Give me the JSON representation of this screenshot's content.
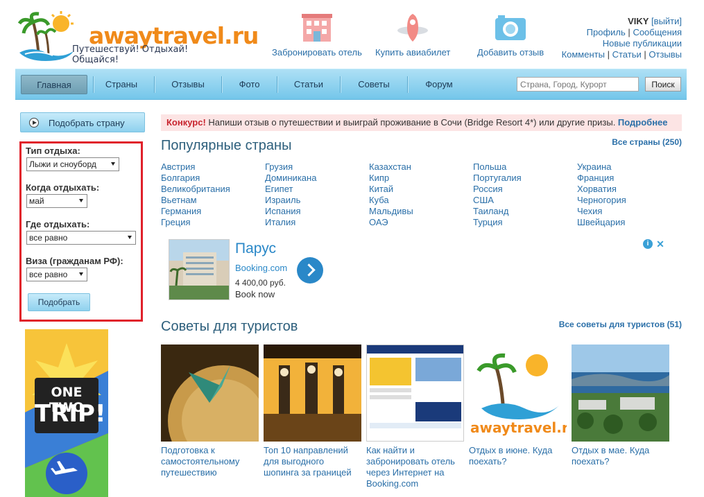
{
  "header": {
    "logo_text": "awaytravel.ru",
    "slogan": "Путешествуй! Отдыхай! Общайся!",
    "links": [
      {
        "label": "Забронировать отель",
        "icon": "hotel-icon"
      },
      {
        "label": "Купить авиабилет",
        "icon": "airplane-icon"
      },
      {
        "label": "Добавить отзыв",
        "icon": "camera-icon"
      }
    ],
    "user": {
      "name": "VIKY",
      "logout": "[выйти]",
      "profile": "Профиль",
      "messages": "Сообщения",
      "new_publications": "Новые публикации",
      "comments": "Комменты",
      "articles": "Статьи",
      "reviews": "Отзывы",
      "separator": "|"
    }
  },
  "nav": {
    "items": [
      "Главная",
      "Страны",
      "Отзывы",
      "Фото",
      "Статьи",
      "Советы",
      "Форум"
    ],
    "active": "Главная",
    "search_placeholder": "Страна, Город, Курорт",
    "search_button": "Поиск"
  },
  "sidebar": {
    "pick_country": "Подобрать страну",
    "filter": {
      "type_label": "Тип отдыха:",
      "type_value": "Лыжи и сноуборд",
      "when_label": "Когда отдыхать:",
      "when_value": "май",
      "where_label": "Где отдыхать:",
      "where_value": "все равно",
      "visa_label": "Виза (гражданам РФ):",
      "visa_value": "все равно",
      "submit": "Подобрать"
    },
    "banner": {
      "line1": "ONE TWO",
      "line2": "TRIP!"
    }
  },
  "contest": {
    "highlight": "Конкурс!",
    "text": " Напиши отзыв о путешествии и выиграй проживание в Сочи (Bridge Resort 4*) или другие призы. ",
    "more": "Подробнее"
  },
  "countries": {
    "title": "Популярные страны",
    "all": "Все страны (250)",
    "columns": [
      [
        "Австрия",
        "Болгария",
        "Великобритания",
        "Вьетнам",
        "Германия",
        "Греция"
      ],
      [
        "Грузия",
        "Доминикана",
        "Египет",
        "Израиль",
        "Испания",
        "Италия"
      ],
      [
        "Казахстан",
        "Кипр",
        "Китай",
        "Куба",
        "Мальдивы",
        "ОАЭ"
      ],
      [
        "Польша",
        "Португалия",
        "Россия",
        "США",
        "Таиланд",
        "Турция"
      ],
      [
        "Украина",
        "Франция",
        "Хорватия",
        "Черногория",
        "Чехия",
        "Швейцария"
      ]
    ]
  },
  "booking_ad": {
    "hotel_name": "Парус",
    "site": "Booking.com",
    "price": "4 400,00 руб.",
    "cta": "Book now",
    "info": "i",
    "close": "✕"
  },
  "tips": {
    "title": "Советы для туристов",
    "all": "Все советы для туристов (51)",
    "items": [
      {
        "caption": "Подготовка к самостоятельному путешествию"
      },
      {
        "caption": "Топ 10 направлений для выгодного шопинга за границей"
      },
      {
        "caption": "Как найти и забронировать отель через Интернет на Booking.com"
      },
      {
        "caption": "Отдых в июне. Куда поехать?",
        "logo": "awaytravel.ru"
      },
      {
        "caption": "Отдых в мае. Куда поехать?"
      }
    ]
  },
  "colors": {
    "accent": "#2a6fa8",
    "nav": "#74c6ea",
    "contest_bg": "#fce4e4",
    "logo_orange": "#f08a1a",
    "highlight_red": "#e0202a"
  }
}
